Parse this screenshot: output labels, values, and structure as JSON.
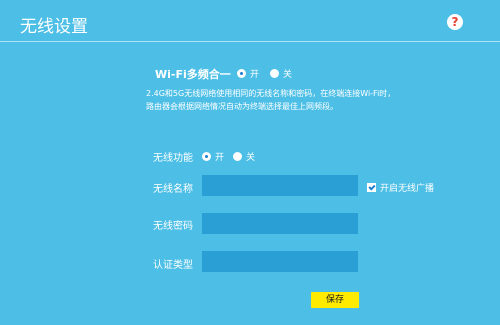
{
  "header": {
    "title": "无线设置",
    "help_icon": "?"
  },
  "dual_band": {
    "label": "Wi-Fi多频合一",
    "on_label": "开",
    "off_label": "关",
    "selected": "on",
    "description_line1": "2.4G和5G无线网络使用相同的无线名称和密码，在终端连接Wi-Fi时，",
    "description_line2": "路由器会根据网络情况自动为终端选择最佳上网频段。"
  },
  "wireless_function": {
    "label": "无线功能",
    "on_label": "开",
    "off_label": "关",
    "selected": "on"
  },
  "wireless_name": {
    "label": "无线名称",
    "value": "",
    "broadcast_label": "开启无线广播",
    "broadcast_checked": true
  },
  "wireless_password": {
    "label": "无线密码",
    "value": ""
  },
  "auth_type": {
    "label": "认证类型",
    "value": ""
  },
  "footer": {
    "save_label": "保存"
  },
  "colors": {
    "background": "#4dbfe6",
    "input_background": "#2a9fd6",
    "save_button": "#ffeb00",
    "help_icon": "#e8402f"
  }
}
